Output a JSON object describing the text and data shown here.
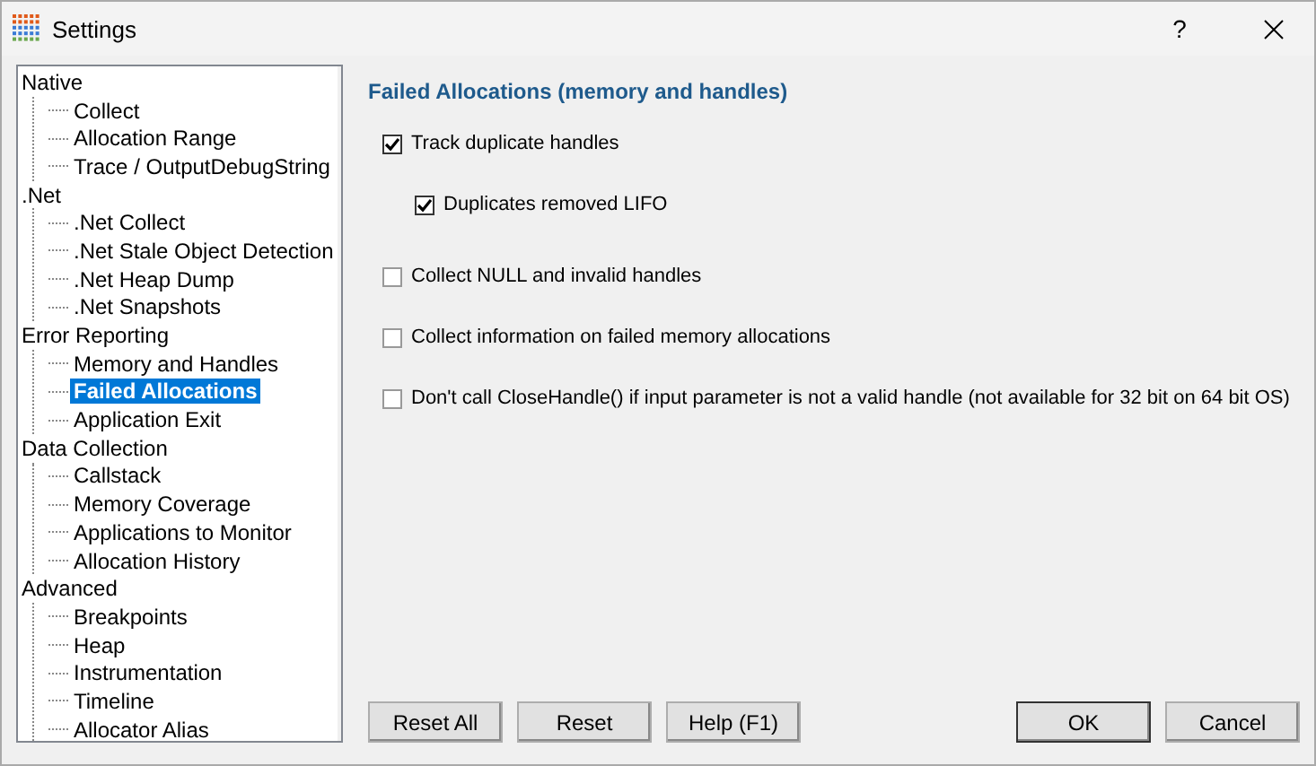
{
  "window": {
    "title": "Settings",
    "help_button": "?"
  },
  "tree": [
    {
      "label": "Native",
      "selected": false,
      "children": [
        {
          "label": "Collect",
          "selected": false
        },
        {
          "label": "Allocation Range",
          "selected": false
        },
        {
          "label": "Trace / OutputDebugString",
          "selected": false
        }
      ]
    },
    {
      "label": ".Net",
      "selected": false,
      "children": [
        {
          "label": ".Net Collect",
          "selected": false
        },
        {
          "label": ".Net Stale Object Detection",
          "selected": false
        },
        {
          "label": ".Net Heap Dump",
          "selected": false
        },
        {
          "label": ".Net Snapshots",
          "selected": false
        }
      ]
    },
    {
      "label": "Error Reporting",
      "selected": false,
      "children": [
        {
          "label": "Memory and Handles",
          "selected": false
        },
        {
          "label": "Failed Allocations",
          "selected": true
        },
        {
          "label": "Application Exit",
          "selected": false
        }
      ]
    },
    {
      "label": "Data Collection",
      "selected": false,
      "children": [
        {
          "label": "Callstack",
          "selected": false
        },
        {
          "label": "Memory Coverage",
          "selected": false
        },
        {
          "label": "Applications to Monitor",
          "selected": false
        },
        {
          "label": "Allocation History",
          "selected": false
        }
      ]
    },
    {
      "label": "Advanced",
      "selected": false,
      "children": [
        {
          "label": "Breakpoints",
          "selected": false
        },
        {
          "label": "Heap",
          "selected": false
        },
        {
          "label": "Instrumentation",
          "selected": false
        },
        {
          "label": "Timeline",
          "selected": false
        },
        {
          "label": "Allocator Alias",
          "selected": false
        }
      ]
    }
  ],
  "panel": {
    "heading": "Failed Allocations (memory and handles)",
    "options": [
      {
        "label": "Track duplicate handles",
        "checked": true,
        "children": [
          {
            "label": "Duplicates removed LIFO",
            "checked": true
          }
        ]
      },
      {
        "label": "Collect NULL and invalid handles",
        "checked": false
      },
      {
        "label": "Collect information on failed memory allocations",
        "checked": false
      },
      {
        "label": "Don't call CloseHandle() if input parameter is not a valid handle (not available for 32 bit on 64 bit OS)",
        "checked": false
      }
    ]
  },
  "buttons_left": [
    "Reset All",
    "Reset",
    "Help (F1)"
  ],
  "buttons_right": [
    {
      "label": "OK",
      "default": true
    },
    {
      "label": "Cancel",
      "default": false
    }
  ]
}
